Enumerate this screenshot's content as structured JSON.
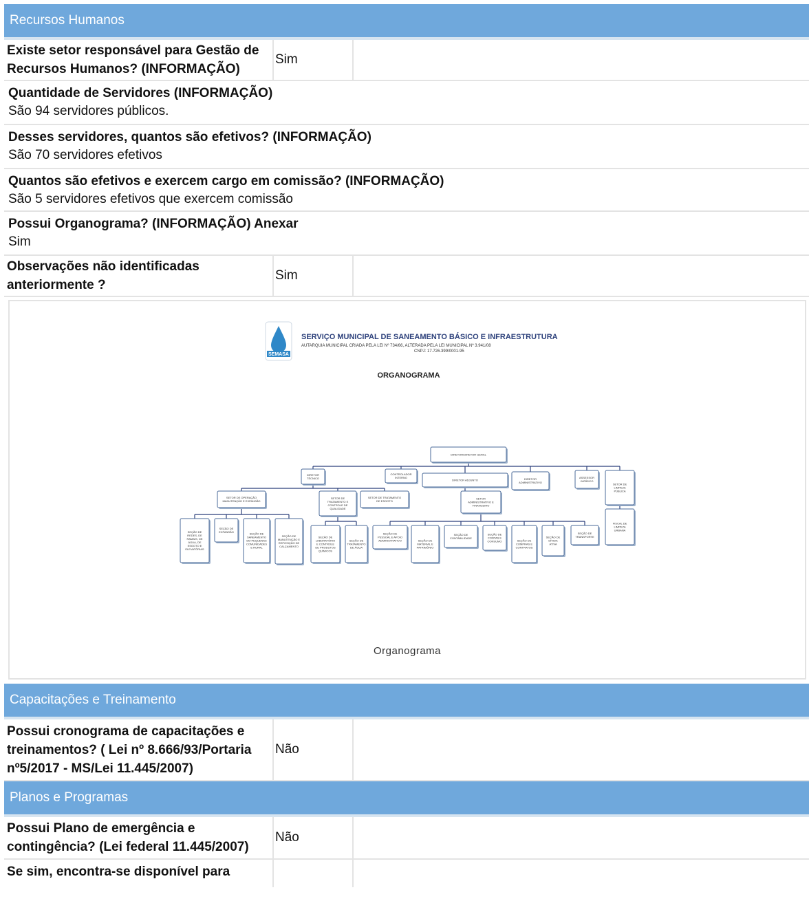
{
  "sections": {
    "rh": {
      "title": "Recursos Humanos",
      "q1": {
        "label": "Existe setor responsável para Gestão de Recursos Humanos? (INFORMAÇÃO)",
        "value": "Sim"
      },
      "q2": {
        "label": "Quantidade de Servidores (INFORMAÇÃO)",
        "value": "São 94 servidores públicos."
      },
      "q3": {
        "label": "Desses servidores, quantos são efetivos? (INFORMAÇÃO)",
        "value": "São 70 servidores efetivos"
      },
      "q4": {
        "label": "Quantos são efetivos e exercem cargo em comissão? (INFORMAÇÃO)",
        "value": "São 5 servidores efetivos que exercem comissão"
      },
      "q5": {
        "label": "Possui Organograma? (INFORMAÇÃO) Anexar",
        "value": "Sim"
      },
      "q6": {
        "label": "Observações não identificadas anteriormente ?",
        "value": "Sim"
      }
    },
    "cap": {
      "title": "Capacitações e Treinamento",
      "q1": {
        "label": "Possui cronograma de capacitações e treinamentos? ( Lei nº 8.666/93/Portaria nº5/2017 - MS/Lei 11.445/2007)",
        "value": "Não"
      }
    },
    "planos": {
      "title": "Planos e Programas",
      "q1": {
        "label": "Possui Plano de emergência e contingência? (Lei federal 11.445/2007)",
        "value": "Não"
      },
      "q2": {
        "label": "Se sim, encontra-se disponível para",
        "value": ""
      }
    }
  },
  "organograma": {
    "caption": "Organograma",
    "header_title": "SERVIÇO MUNICIPAL DE SANEAMENTO BÁSICO E INFRAESTRUTURA",
    "header_sub1": "AUTARQUIA MUNICIPAL CRIADA PELA LEI Nº 734/66, ALTERADA PELA LEI MUNICIPAL Nº 3.941/08",
    "header_sub2": "CNPJ: 17.726.399/0001-95",
    "logo_text": "SEMASA",
    "doc_title": "ORGANOGRAMA",
    "nodes": {
      "diretor_geral": "DIRETOR/DIRETOR GERAL",
      "diretor_tecnico": "DIRETOR TÉCNICO",
      "controlador": "CONTROLADOR INTERNO",
      "diretor_adjunto": "DIRETOR ADJUNTO",
      "diretor_adm": "DIRETOR ADMINISTRATIVO",
      "assessor": "ASSESSOR JURÍDICO",
      "setor_limpeza": "SETOR DE LIMPEZA PÚBLICA",
      "setor_operacao": "SETOR DE OPERAÇÃO MANUTENÇÃO E EXPANSÃO",
      "setor_tratamento_agua": "SETOR DE TRATAMENTO E CONTROLE DE QUALIDADE",
      "setor_tratamento_esgoto": "SETOR DE TRATAMENTO DE ESGOTO",
      "setor_adm_fin": "SETOR ADMINISTRATIVO E FINANCEIRO",
      "fiscal_limpeza": "FISCAL DE LIMPEZA URBANA",
      "s_redes": "SEÇÃO DE REDES, DE RAMAIS, DE ÁGUA, DE ESGOTO E ELEVATÓRIAS",
      "s_expansao": "SEÇÃO DE EXPANSÃO",
      "s_saneamento": "SEÇÃO DE SANEAMENTO EM PEQUENAS COMUNIDADES E RURAL",
      "s_calcamento": "SEÇÃO DE MANUTENÇÃO E REPOSIÇÃO DE CALÇAMENTO",
      "s_laboratorio": "SEÇÃO DE LABORATÓRIO E CONTROLE DE PRODUTOS QUÍMICOS",
      "s_trat_agua": "SEÇÃO DE TRATAMENTO DE ÁGUA",
      "s_pessoal": "SEÇÃO DE PESSOAL E APOIO ADMINISTRATIVO",
      "s_material": "SEÇÃO DE MATERIAL E PATRIMÔNIO",
      "s_contab": "SEÇÃO DE CONTABILIDADE",
      "s_contas": "SEÇÃO DE CONTAS E CONSUMO",
      "s_compras": "SEÇÃO DE COMPRAS E CONTRATOS",
      "s_divida": "SEÇÃO DE DÍVIDA ATIVA",
      "s_transporte": "SEÇÃO DE TRANSPORTE"
    }
  },
  "colors": {
    "header_bg": "#6fa8dc",
    "header_text": "#ffffff",
    "border": "#e3e3e3",
    "logo_blue": "#2f88c8",
    "brand_title": "#2b3f7a"
  }
}
